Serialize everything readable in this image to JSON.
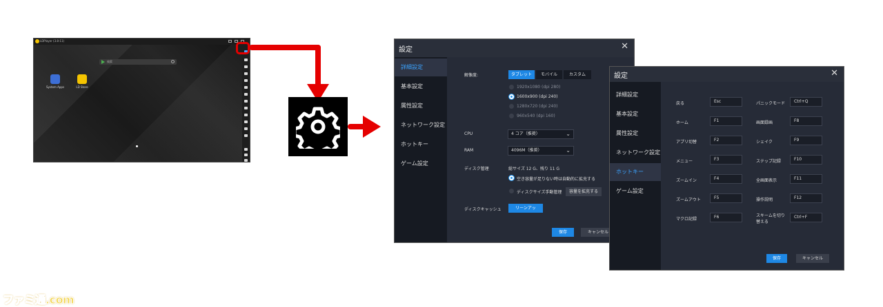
{
  "emulator": {
    "title": "LDPlayer (3.8-11)",
    "search_placeholder": "検索",
    "apps": [
      {
        "label": "System Apps",
        "color": "#3d6fd6"
      },
      {
        "label": "LD Store",
        "color": "#f5c400"
      }
    ]
  },
  "settings1": {
    "title": "設定",
    "close": "✕",
    "nav": [
      "詳細設定",
      "基本設定",
      "属性設定",
      "ネットワーク設定",
      "ホットキー",
      "ゲーム設定"
    ],
    "resolution_label": "解像度:",
    "resolution_tabs": [
      "タブレット",
      "モバイル",
      "カスタム"
    ],
    "resolution_options": [
      "1920x1080 (dpi 280)",
      "1600x900 (dpi 240)",
      "1280x720 (dpi 240)",
      "960x540 (dpi 160)"
    ],
    "cpu_label": "CPU",
    "cpu_value": "4 コア（推奨）",
    "ram_label": "RAM",
    "ram_value": "4096M（推奨）",
    "disk_label": "ディスク管理",
    "disk_info": "総サイズ 12 G、残り 11 G",
    "disk_opt_auto": "空き容量が足りない時は自動的に拡充する",
    "disk_opt_manual": "ディスクサイズ手動管理",
    "disk_expand": "容量を拡充する",
    "cache_label": "ディスクキャッシュ",
    "cache_button": "リーンアッ",
    "save": "保存",
    "cancel": "キャンセル"
  },
  "settings2": {
    "title": "設定",
    "close": "✕",
    "nav": [
      "詳細設定",
      "基本設定",
      "属性設定",
      "ネットワーク設定",
      "ホットキー",
      "ゲーム設定"
    ],
    "hotkeys_left": [
      {
        "label": "戻る",
        "key": "Esc"
      },
      {
        "label": "ホーム",
        "key": "F1"
      },
      {
        "label": "アプリ切替",
        "key": "F2"
      },
      {
        "label": "メニュー",
        "key": "F3"
      },
      {
        "label": "ズームイン",
        "key": "F4"
      },
      {
        "label": "ズームアウト",
        "key": "F5"
      },
      {
        "label": "マクロ記録",
        "key": "F6"
      }
    ],
    "hotkeys_right": [
      {
        "label": "パニックモード",
        "key": "Ctrl+Q"
      },
      {
        "label": "画面録画",
        "key": "F8"
      },
      {
        "label": "シェイク",
        "key": "F9"
      },
      {
        "label": "ステップ記録",
        "key": "F10"
      },
      {
        "label": "全画面表示",
        "key": "F11"
      },
      {
        "label": "操作説明",
        "key": "F12"
      },
      {
        "label": "スキームを切り替える",
        "key": "Ctrl+F"
      }
    ],
    "save": "保存",
    "cancel": "キャンセル"
  },
  "watermark": "ファミ通.com"
}
